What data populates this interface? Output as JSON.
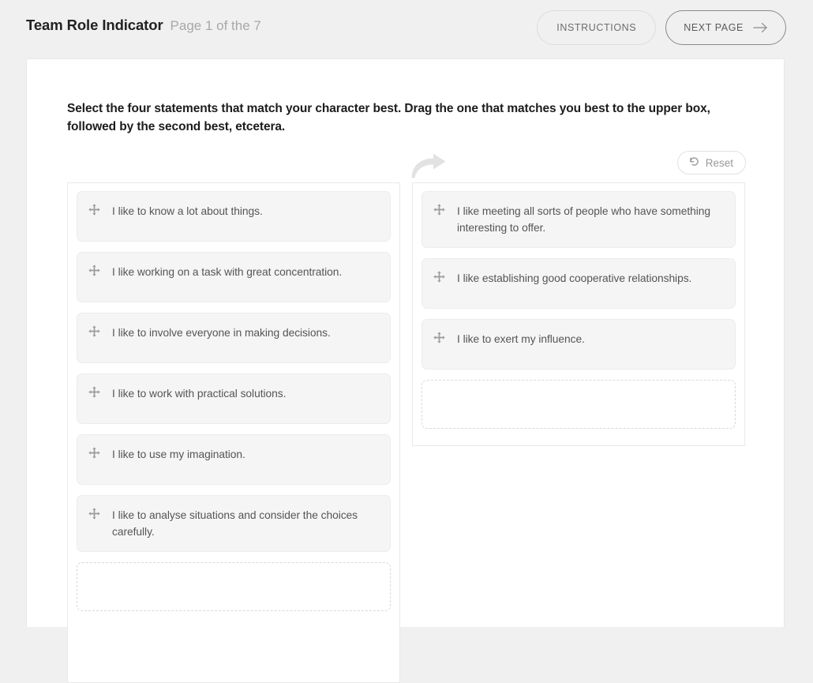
{
  "header": {
    "title": "Team Role Indicator",
    "page_label": "Page 1 of the 7",
    "instructions_label": "INSTRUCTIONS",
    "next_page_label": "NEXT PAGE",
    "next_icon": "arrow-right-icon"
  },
  "main": {
    "prompt": "Select the four statements that match your character best. Drag the one that matches you best to the upper box, followed by the second best, etcetera.",
    "hint_icon": "curved-arrow-right-icon",
    "reset_label": "Reset",
    "reset_icon": "reset-ccw-icon",
    "drag_icon": "move-arrows-icon"
  },
  "columns": {
    "source": {
      "items": [
        {
          "text": "I like to know a lot about things."
        },
        {
          "text": "I like working on a task with great concentration."
        },
        {
          "text": "I like to involve everyone in making decisions."
        },
        {
          "text": "I like to work with practical solutions."
        },
        {
          "text": "I like to use my imagination."
        },
        {
          "text": "I like to analyse situations and consider the choices carefully."
        }
      ],
      "has_dropzone": true
    },
    "target": {
      "items": [
        {
          "text": "I like meeting all sorts of people who have something interesting to offer."
        },
        {
          "text": "I like establishing good cooperative relationships."
        },
        {
          "text": "I like to exert my influence."
        }
      ],
      "has_dropzone": true
    }
  },
  "colors": {
    "page_background": "#f0f0f0",
    "card_background": "#ffffff",
    "statement_background": "#f5f5f5",
    "statement_border": "#ececec",
    "dropzone_border": "#d9d9d9",
    "muted_text": "#a8a8a8",
    "body_text": "#555555"
  }
}
